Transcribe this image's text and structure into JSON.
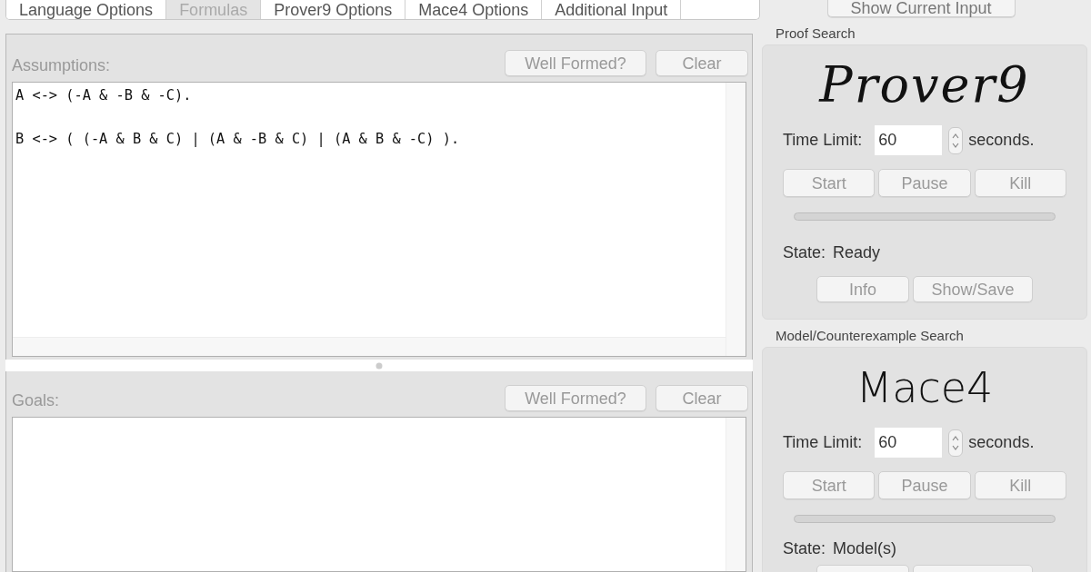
{
  "tabs": [
    {
      "label": "Language Options",
      "selected": false
    },
    {
      "label": "Formulas",
      "selected": true
    },
    {
      "label": "Prover9 Options",
      "selected": false
    },
    {
      "label": "Mace4 Options",
      "selected": false
    },
    {
      "label": "Additional Input",
      "selected": false
    }
  ],
  "show_input_button": {
    "label": "Show Current Input",
    "disabled": false
  },
  "formulas": [
    {
      "title": "Assumptions:",
      "buttons": [
        {
          "label": "Well Formed?",
          "disabled": true
        },
        {
          "label": "Clear",
          "disabled": true
        }
      ],
      "text": "A <-> (-A & -B & -C).\n\nB <-> ( (-A & B & C) | (A & -B & C) | (A & B & -C) )."
    },
    {
      "title": "Goals:",
      "buttons": [
        {
          "label": "Well Formed?",
          "disabled": true
        },
        {
          "label": "Clear",
          "disabled": true
        }
      ]
    }
  ],
  "searches": [
    {
      "heading": "Proof Search",
      "logo": "Prover9",
      "time_limit_label": "Time Limit:",
      "time_limit": "60",
      "unit": "seconds.",
      "buttons": [
        {
          "label": "Start",
          "disabled": true
        },
        {
          "label": "Pause",
          "disabled": true
        },
        {
          "label": "Kill",
          "disabled": true
        }
      ],
      "progress": {
        "level": 0
      },
      "state_label": "State:",
      "state": "Ready",
      "extra_buttons": [
        {
          "label": "Info",
          "disabled": true
        },
        {
          "label": "Show/Save",
          "disabled": true
        }
      ]
    },
    {
      "heading": "Model/Counterexample Search",
      "logo": "Mace4",
      "time_limit_label": "Time Limit:",
      "time_limit": "60",
      "unit": "seconds.",
      "buttons": [
        {
          "label": "Start",
          "disabled": true
        },
        {
          "label": "Pause",
          "disabled": true
        },
        {
          "label": "Kill",
          "disabled": true
        }
      ],
      "progress": {
        "level": 0
      },
      "state_label": "State:",
      "state": "Model(s)",
      "extra_buttons": [
        {
          "kind": "cut"
        },
        {
          "kind": "cut"
        }
      ]
    }
  ]
}
